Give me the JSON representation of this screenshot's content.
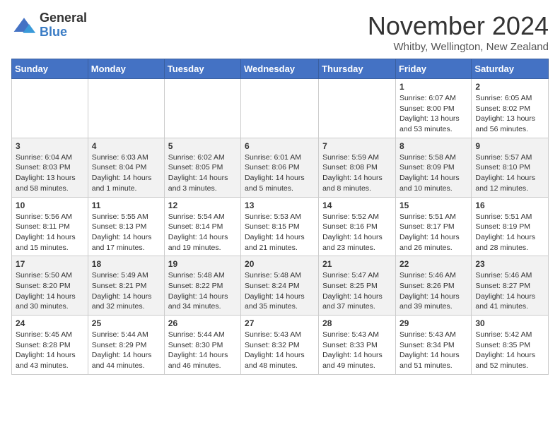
{
  "logo": {
    "general": "General",
    "blue": "Blue"
  },
  "header": {
    "month": "November 2024",
    "location": "Whitby, Wellington, New Zealand"
  },
  "weekdays": [
    "Sunday",
    "Monday",
    "Tuesday",
    "Wednesday",
    "Thursday",
    "Friday",
    "Saturday"
  ],
  "weeks": [
    [
      {
        "day": "",
        "sunrise": "",
        "sunset": "",
        "daylight": ""
      },
      {
        "day": "",
        "sunrise": "",
        "sunset": "",
        "daylight": ""
      },
      {
        "day": "",
        "sunrise": "",
        "sunset": "",
        "daylight": ""
      },
      {
        "day": "",
        "sunrise": "",
        "sunset": "",
        "daylight": ""
      },
      {
        "day": "",
        "sunrise": "",
        "sunset": "",
        "daylight": ""
      },
      {
        "day": "1",
        "sunrise": "Sunrise: 6:07 AM",
        "sunset": "Sunset: 8:00 PM",
        "daylight": "Daylight: 13 hours and 53 minutes."
      },
      {
        "day": "2",
        "sunrise": "Sunrise: 6:05 AM",
        "sunset": "Sunset: 8:02 PM",
        "daylight": "Daylight: 13 hours and 56 minutes."
      }
    ],
    [
      {
        "day": "3",
        "sunrise": "Sunrise: 6:04 AM",
        "sunset": "Sunset: 8:03 PM",
        "daylight": "Daylight: 13 hours and 58 minutes."
      },
      {
        "day": "4",
        "sunrise": "Sunrise: 6:03 AM",
        "sunset": "Sunset: 8:04 PM",
        "daylight": "Daylight: 14 hours and 1 minute."
      },
      {
        "day": "5",
        "sunrise": "Sunrise: 6:02 AM",
        "sunset": "Sunset: 8:05 PM",
        "daylight": "Daylight: 14 hours and 3 minutes."
      },
      {
        "day": "6",
        "sunrise": "Sunrise: 6:01 AM",
        "sunset": "Sunset: 8:06 PM",
        "daylight": "Daylight: 14 hours and 5 minutes."
      },
      {
        "day": "7",
        "sunrise": "Sunrise: 5:59 AM",
        "sunset": "Sunset: 8:08 PM",
        "daylight": "Daylight: 14 hours and 8 minutes."
      },
      {
        "day": "8",
        "sunrise": "Sunrise: 5:58 AM",
        "sunset": "Sunset: 8:09 PM",
        "daylight": "Daylight: 14 hours and 10 minutes."
      },
      {
        "day": "9",
        "sunrise": "Sunrise: 5:57 AM",
        "sunset": "Sunset: 8:10 PM",
        "daylight": "Daylight: 14 hours and 12 minutes."
      }
    ],
    [
      {
        "day": "10",
        "sunrise": "Sunrise: 5:56 AM",
        "sunset": "Sunset: 8:11 PM",
        "daylight": "Daylight: 14 hours and 15 minutes."
      },
      {
        "day": "11",
        "sunrise": "Sunrise: 5:55 AM",
        "sunset": "Sunset: 8:13 PM",
        "daylight": "Daylight: 14 hours and 17 minutes."
      },
      {
        "day": "12",
        "sunrise": "Sunrise: 5:54 AM",
        "sunset": "Sunset: 8:14 PM",
        "daylight": "Daylight: 14 hours and 19 minutes."
      },
      {
        "day": "13",
        "sunrise": "Sunrise: 5:53 AM",
        "sunset": "Sunset: 8:15 PM",
        "daylight": "Daylight: 14 hours and 21 minutes."
      },
      {
        "day": "14",
        "sunrise": "Sunrise: 5:52 AM",
        "sunset": "Sunset: 8:16 PM",
        "daylight": "Daylight: 14 hours and 23 minutes."
      },
      {
        "day": "15",
        "sunrise": "Sunrise: 5:51 AM",
        "sunset": "Sunset: 8:17 PM",
        "daylight": "Daylight: 14 hours and 26 minutes."
      },
      {
        "day": "16",
        "sunrise": "Sunrise: 5:51 AM",
        "sunset": "Sunset: 8:19 PM",
        "daylight": "Daylight: 14 hours and 28 minutes."
      }
    ],
    [
      {
        "day": "17",
        "sunrise": "Sunrise: 5:50 AM",
        "sunset": "Sunset: 8:20 PM",
        "daylight": "Daylight: 14 hours and 30 minutes."
      },
      {
        "day": "18",
        "sunrise": "Sunrise: 5:49 AM",
        "sunset": "Sunset: 8:21 PM",
        "daylight": "Daylight: 14 hours and 32 minutes."
      },
      {
        "day": "19",
        "sunrise": "Sunrise: 5:48 AM",
        "sunset": "Sunset: 8:22 PM",
        "daylight": "Daylight: 14 hours and 34 minutes."
      },
      {
        "day": "20",
        "sunrise": "Sunrise: 5:48 AM",
        "sunset": "Sunset: 8:24 PM",
        "daylight": "Daylight: 14 hours and 35 minutes."
      },
      {
        "day": "21",
        "sunrise": "Sunrise: 5:47 AM",
        "sunset": "Sunset: 8:25 PM",
        "daylight": "Daylight: 14 hours and 37 minutes."
      },
      {
        "day": "22",
        "sunrise": "Sunrise: 5:46 AM",
        "sunset": "Sunset: 8:26 PM",
        "daylight": "Daylight: 14 hours and 39 minutes."
      },
      {
        "day": "23",
        "sunrise": "Sunrise: 5:46 AM",
        "sunset": "Sunset: 8:27 PM",
        "daylight": "Daylight: 14 hours and 41 minutes."
      }
    ],
    [
      {
        "day": "24",
        "sunrise": "Sunrise: 5:45 AM",
        "sunset": "Sunset: 8:28 PM",
        "daylight": "Daylight: 14 hours and 43 minutes."
      },
      {
        "day": "25",
        "sunrise": "Sunrise: 5:44 AM",
        "sunset": "Sunset: 8:29 PM",
        "daylight": "Daylight: 14 hours and 44 minutes."
      },
      {
        "day": "26",
        "sunrise": "Sunrise: 5:44 AM",
        "sunset": "Sunset: 8:30 PM",
        "daylight": "Daylight: 14 hours and 46 minutes."
      },
      {
        "day": "27",
        "sunrise": "Sunrise: 5:43 AM",
        "sunset": "Sunset: 8:32 PM",
        "daylight": "Daylight: 14 hours and 48 minutes."
      },
      {
        "day": "28",
        "sunrise": "Sunrise: 5:43 AM",
        "sunset": "Sunset: 8:33 PM",
        "daylight": "Daylight: 14 hours and 49 minutes."
      },
      {
        "day": "29",
        "sunrise": "Sunrise: 5:43 AM",
        "sunset": "Sunset: 8:34 PM",
        "daylight": "Daylight: 14 hours and 51 minutes."
      },
      {
        "day": "30",
        "sunrise": "Sunrise: 5:42 AM",
        "sunset": "Sunset: 8:35 PM",
        "daylight": "Daylight: 14 hours and 52 minutes."
      }
    ]
  ]
}
